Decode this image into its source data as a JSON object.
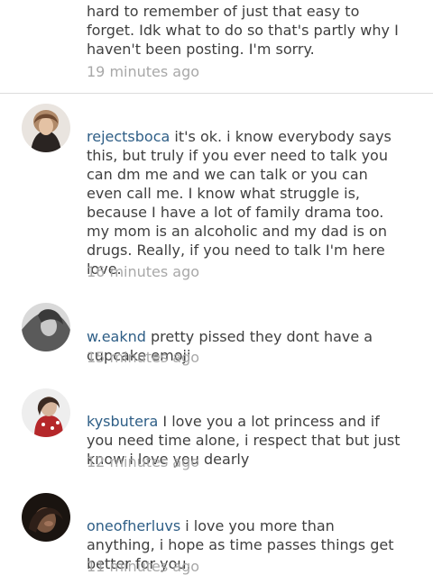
{
  "comments": [
    {
      "username": "",
      "text": "hard to remember of just that easy to\nforget. Idk what to do so that's partly why I\nhaven't been posting. I'm sorry.",
      "time": "19 minutes ago"
    },
    {
      "username": "rejectsboca",
      "text": " it's ok. i know everybody says\nthis, but truly if you ever need to talk you\ncan dm me and we can talk or you can\neven call me. I know what struggle is,\nbecause I have a lot of family drama too.\nmy mom is an alcoholic and my dad is on\ndrugs. Really, if you need to talk I'm here\nlove.",
      "time": "16 minutes ago"
    },
    {
      "username": "w.eaknd",
      "text": " pretty pissed they dont have a\ncupcake emoji",
      "time": "15 minutes ago"
    },
    {
      "username": "kysbutera",
      "text": " I love you a lot princess and if\nyou need time alone, i respect that but just\nknow i love you dearly",
      "time": "12 minutes ago"
    },
    {
      "username": "oneofherluvs",
      "text": " i love you more than\nanything, i hope as time passes things get\nbetter for you.",
      "time": "11 minutes ago"
    }
  ]
}
